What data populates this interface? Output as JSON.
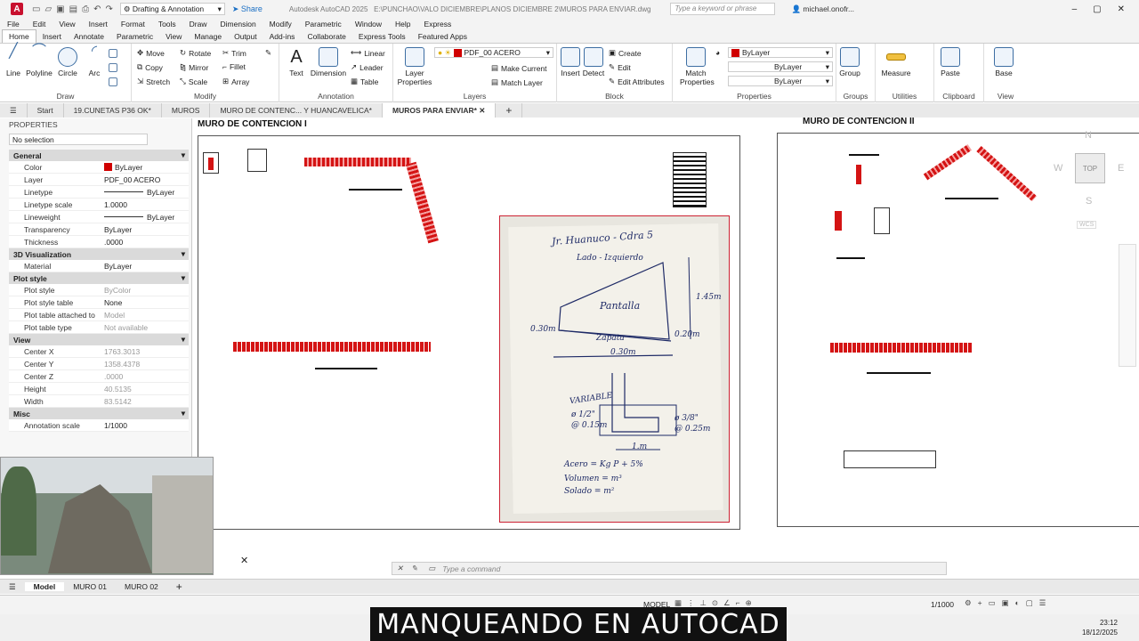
{
  "app": {
    "logo": "A",
    "title": "Autodesk AutoCAD 2025",
    "path": "E:\\PUNCHAO\\VALO DICIEMBRE\\PLANOS DICIEMBRE 2\\MUROS PARA ENVIAR.dwg",
    "workspace": "Drafting & Annotation",
    "share": "Share",
    "search_placeholder": "Type a keyword or phrase",
    "user": "michael.onofr..."
  },
  "menu": [
    "File",
    "Edit",
    "View",
    "Insert",
    "Format",
    "Tools",
    "Draw",
    "Dimension",
    "Modify",
    "Parametric",
    "Window",
    "Help",
    "Express"
  ],
  "ribbon_tabs": [
    "Home",
    "Insert",
    "Annotate",
    "Parametric",
    "View",
    "Manage",
    "Output",
    "Add-ins",
    "Collaborate",
    "Express Tools",
    "Featured Apps"
  ],
  "ribbon": {
    "draw": {
      "title": "Draw",
      "line": "Line",
      "polyline": "Polyline",
      "circle": "Circle",
      "arc": "Arc"
    },
    "modify": {
      "title": "Modify",
      "move": "Move",
      "rotate": "Rotate",
      "trim": "Trim",
      "copy": "Copy",
      "mirror": "Mirror",
      "fillet": "Fillet",
      "stretch": "Stretch",
      "scale": "Scale",
      "array": "Array"
    },
    "annotation": {
      "title": "Annotation",
      "text": "Text",
      "dimension": "Dimension",
      "linear": "Linear",
      "leader": "Leader",
      "table": "Table"
    },
    "layers": {
      "title": "Layers",
      "layer_properties": "Layer Properties",
      "current_layer": "PDF_00 ACERO",
      "make_current": "Make Current",
      "match_layer": "Match Layer"
    },
    "block": {
      "title": "Block",
      "insert": "Insert",
      "detect": "Detect",
      "create": "Create",
      "edit": "Edit",
      "edit_attributes": "Edit Attributes"
    },
    "properties": {
      "title": "Properties",
      "match": "Match Properties",
      "color": "ByLayer",
      "linetype": "ByLayer",
      "lineweight": "ByLayer"
    },
    "groups": {
      "title": "Groups",
      "group": "Group"
    },
    "utilities": {
      "title": "Utilities",
      "measure": "Measure"
    },
    "clipboard": {
      "title": "Clipboard",
      "paste": "Paste"
    },
    "view": {
      "title": "View",
      "base": "Base"
    }
  },
  "file_tabs": [
    "Start",
    "19.CUNETAS P36 OK*",
    "MUROS",
    "MURO DE CONTENC... Y HUANCAVELICA*",
    "MUROS PARA ENVIAR*"
  ],
  "properties_panel": {
    "header": "PROPERTIES",
    "selection": "No selection",
    "general": {
      "title": "General",
      "rows": [
        [
          "Color",
          "ByLayer"
        ],
        [
          "Layer",
          "PDF_00 ACERO"
        ],
        [
          "Linetype",
          "ByLayer"
        ],
        [
          "Linetype scale",
          "1.0000"
        ],
        [
          "Lineweight",
          "ByLayer"
        ],
        [
          "Transparency",
          "ByLayer"
        ],
        [
          "Thickness",
          ".0000"
        ]
      ]
    },
    "visualization": {
      "title": "3D Visualization",
      "rows": [
        [
          "Material",
          "ByLayer"
        ]
      ]
    },
    "plot_style": {
      "title": "Plot style",
      "rows": [
        [
          "Plot style",
          "ByColor"
        ],
        [
          "Plot style table",
          "None"
        ],
        [
          "Plot table attached to",
          "Model"
        ],
        [
          "Plot table type",
          "Not available"
        ]
      ]
    },
    "view": {
      "title": "View",
      "rows": [
        [
          "Center X",
          "1763.3013"
        ],
        [
          "Center Y",
          "1358.4378"
        ],
        [
          "Center Z",
          ".0000"
        ],
        [
          "Height",
          "40.5135"
        ],
        [
          "Width",
          "83.5142"
        ]
      ]
    },
    "misc": {
      "title": "Misc",
      "rows": [
        [
          "Annotation scale",
          "1/1000"
        ]
      ]
    }
  },
  "drawing": {
    "title_left": "MURO DE CONTENCION I",
    "title_right": "MURO DE CONTENCION II",
    "viewcube": {
      "top": "TOP",
      "n": "N",
      "s": "S",
      "e": "E",
      "w": "W",
      "wcs": "WCS"
    },
    "sketch": {
      "line1": "Jr. Huanuco - Cdra 5",
      "line2": "Lado - Izquierdo",
      "pantalla": "Pantalla",
      "zapata": "Zapata",
      "dim1": "1.45m",
      "dim2": "0.30m",
      "dim3": "0.20m",
      "dim4": "0.30m",
      "dim5": "1.m",
      "variable": "VARIABLE",
      "bar1": "ø 1/2\"",
      "bar2": "@ 0.15m",
      "bar3": "ø 3/8\"",
      "bar4": "@ 0.25m",
      "acero": "Acero = Kg P + 5%",
      "volumen": "Volumen = m³",
      "solado": "Solado = m²"
    }
  },
  "command": {
    "placeholder": "Type a command"
  },
  "layout_tabs": [
    "Model",
    "MURO 01",
    "MURO 02"
  ],
  "status": {
    "model": "MODEL",
    "scale": "1/1000"
  },
  "banner": "MANQUEANDO EN AUTOCAD",
  "clock": {
    "time": "23:12",
    "date": "18/12/2025"
  }
}
